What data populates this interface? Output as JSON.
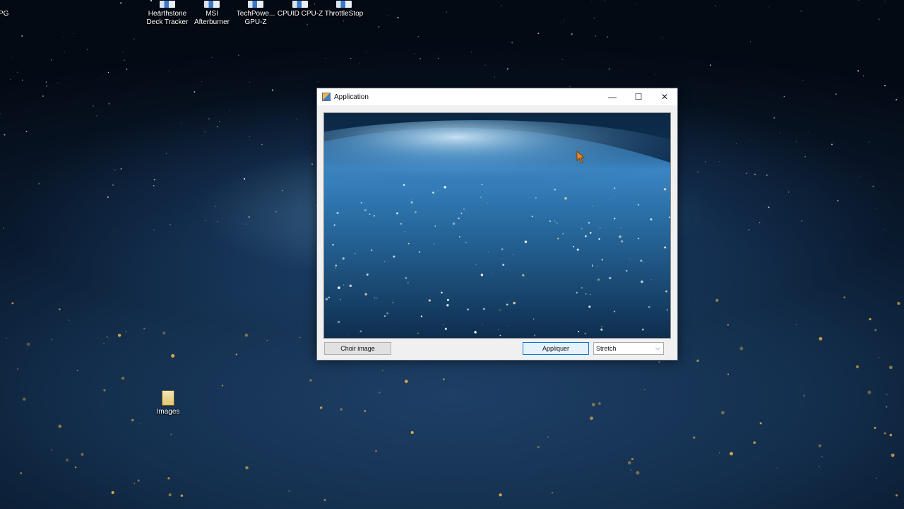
{
  "desktop": {
    "partial_label": "PG",
    "icons": [
      {
        "label": "Hearthstone\nDeck Tracker",
        "icon": "hearthstone-deck-tracker-icon"
      },
      {
        "label": "MSI\nAfterburner",
        "icon": "msi-afterburner-icon"
      },
      {
        "label": "TechPowe...\nGPU-Z",
        "icon": "gpu-z-icon"
      },
      {
        "label": "CPUID CPU-Z",
        "icon": "cpu-z-icon"
      },
      {
        "label": "ThrottleStop",
        "icon": "throttlestop-icon"
      },
      {
        "label": "Images",
        "icon": "folder-icon"
      }
    ]
  },
  "window": {
    "title": "Application",
    "icon": "application-icon",
    "controls": {
      "minimize": "—",
      "maximize": "☐",
      "close": "✕"
    },
    "choose_button": "Choir image",
    "apply_button": "Appliquer",
    "mode_select": {
      "selected": "Stretch",
      "chevron": "⌵"
    }
  },
  "colors": {
    "accent": "#0078d7",
    "window_bg": "#f0f0f0",
    "titlebar_bg": "#ffffff"
  }
}
